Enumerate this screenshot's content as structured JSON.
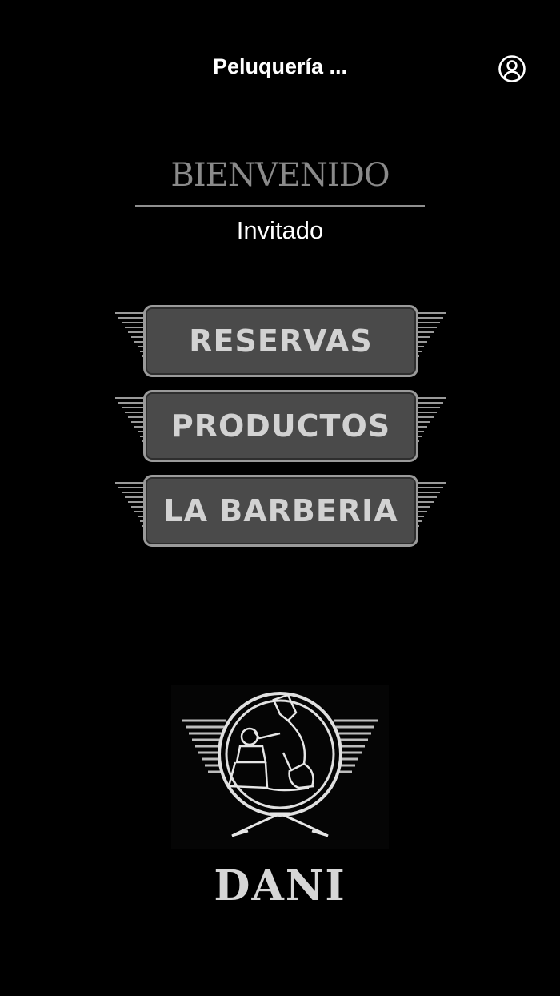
{
  "header": {
    "title": "Peluquería ...",
    "profile_icon": "account-circle-icon"
  },
  "welcome": {
    "title": "BIENVENIDO",
    "user": "Invitado"
  },
  "menu": {
    "items": [
      {
        "label": "RESERVAS"
      },
      {
        "label": "PRODUCTOS"
      },
      {
        "label": "LA BARBERIA"
      }
    ]
  },
  "brand": {
    "logo_icon": "barber-shop-logo-icon",
    "name": "DANI"
  },
  "colors": {
    "background": "#000000",
    "button_fill": "#4a4a4a",
    "button_border": "#9a9a9a",
    "button_text": "#d2d2d2",
    "welcome_title": "#8a8a8a"
  }
}
